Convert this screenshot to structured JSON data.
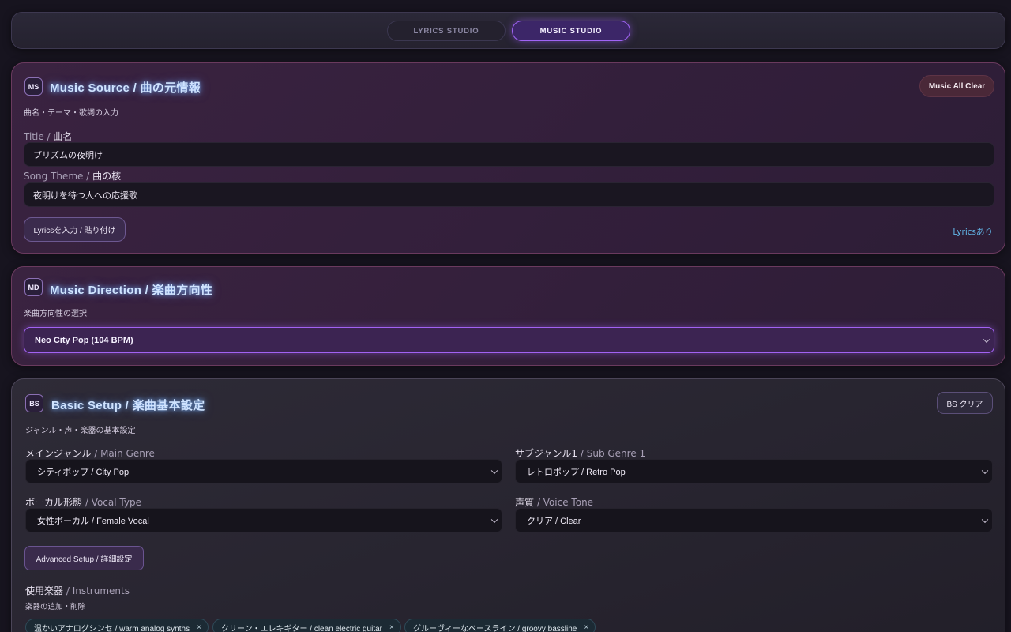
{
  "tabs": [
    {
      "label": "LYRICS STUDIO",
      "active": false
    },
    {
      "label": "MUSIC STUDIO",
      "active": true
    }
  ],
  "music_source": {
    "badge": "MS",
    "title": "Music Source / 曲の元情報",
    "subtitle": "曲名・テーマ・歌詞の入力",
    "clear_label": "Music All Clear",
    "title_label_en": "Title / ",
    "title_label_jp": "曲名",
    "title_value": "プリズムの夜明け",
    "theme_label_en": "Song Theme / ",
    "theme_label_jp": "曲の核",
    "theme_value": "夜明けを待つ人への応援歌",
    "lyrics_button": "Lyricsを入力 / 貼り付け",
    "lyrics_status": "Lyricsあり"
  },
  "music_direction": {
    "badge": "MD",
    "title": "Music Direction / 楽曲方向性",
    "subtitle": "楽曲方向性の選択",
    "selected": "Neo City Pop (104 BPM)"
  },
  "basic_setup": {
    "badge": "BS",
    "title": "Basic Setup / 楽曲基本設定",
    "subtitle": "ジャンル・声・楽器の基本設定",
    "clear_label": "BS クリア",
    "main_genre_label_jp": "メインジャンル",
    "main_genre_label_en": " / Main Genre",
    "main_genre_value": "シティポップ / City Pop",
    "sub_genre_label_jp": "サブジャンル1",
    "sub_genre_label_en": " / Sub Genre 1",
    "sub_genre_value": "レトロポップ / Retro Pop",
    "vocal_type_label_jp": "ボーカル形態",
    "vocal_type_label_en": " / Vocal Type",
    "vocal_type_value": "女性ボーカル / Female Vocal",
    "voice_tone_label_jp": "声質",
    "voice_tone_label_en": " / Voice Tone",
    "voice_tone_value": "クリア / Clear",
    "advanced_button": "Advanced Setup / 詳細設定",
    "instruments_label_jp": "使用楽器",
    "instruments_label_en": " / Instruments",
    "instruments_sub": "楽器の追加・削除",
    "instruments": [
      "温かいアナログシンセ / warm analog synths",
      "クリーン・エレキギター / clean electric guitar",
      "グルーヴィーなベースライン / groovy bassline"
    ],
    "chip_remove": "×"
  },
  "colors": {
    "accent": "#a064f5",
    "title_glow": "#cfe3ff",
    "lyrics_status": "#62b6e8"
  }
}
